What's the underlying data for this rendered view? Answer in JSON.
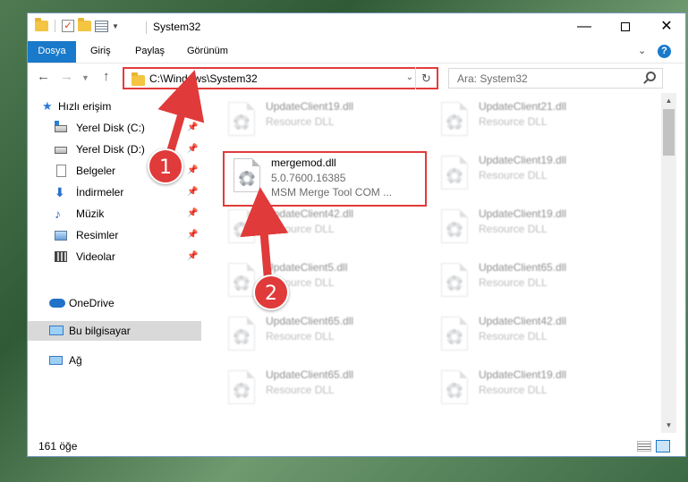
{
  "window": {
    "title": "System32"
  },
  "ribbon": {
    "tabs": [
      "Dosya",
      "Giriş",
      "Paylaş",
      "Görünüm"
    ]
  },
  "nav": {
    "address": "C:\\Windows\\System32",
    "search_placeholder": "Ara: System32"
  },
  "sidebar": {
    "items": [
      {
        "label": "Hızlı erişim",
        "icon": "star-icon"
      },
      {
        "label": "Yerel Disk (C:)",
        "icon": "drive-icon",
        "pinned": true
      },
      {
        "label": "Yerel Disk (D:)",
        "icon": "drive-icon",
        "pinned": true
      },
      {
        "label": "Belgeler",
        "icon": "documents-icon",
        "pinned": true
      },
      {
        "label": "İndirmeler",
        "icon": "download-icon",
        "pinned": true
      },
      {
        "label": "Müzik",
        "icon": "music-icon",
        "pinned": true
      },
      {
        "label": "Resimler",
        "icon": "pictures-icon",
        "pinned": true
      },
      {
        "label": "Videolar",
        "icon": "videos-icon",
        "pinned": true
      },
      {
        "label": "OneDrive",
        "icon": "cloud-icon"
      },
      {
        "label": "Bu bilgisayar",
        "icon": "computer-icon",
        "selected": true
      },
      {
        "label": "Ağ",
        "icon": "network-icon"
      }
    ]
  },
  "files": [
    {
      "name": "UpdateClient19.dll",
      "type": "Resource DLL"
    },
    {
      "name": "UpdateClient21.dll",
      "type": "Resource DLL"
    },
    {
      "name": "mergemod.dll",
      "version": "5.0.7600.16385",
      "description": "MSM Merge Tool COM ..."
    },
    {
      "name": "UpdateClient19.dll",
      "type": "Resource DLL"
    },
    {
      "name": "UpdateClient42.dll",
      "type": "Resource DLL"
    },
    {
      "name": "UpdateClient19.dll",
      "type": "Resource DLL"
    },
    {
      "name": "UpdateClient5.dll",
      "type": "Resource DLL"
    },
    {
      "name": "UpdateClient65.dll",
      "type": "Resource DLL"
    },
    {
      "name": "UpdateClient65.dll",
      "type": "Resource DLL"
    },
    {
      "name": "UpdateClient42.dll",
      "type": "Resource DLL"
    },
    {
      "name": "UpdateClient65.dll",
      "type": "Resource DLL"
    },
    {
      "name": "UpdateClient19.dll",
      "type": "Resource DLL"
    }
  ],
  "status": {
    "item_count": "161 öğe"
  },
  "callouts": [
    "1",
    "2"
  ],
  "colors": {
    "accent": "#1979ca",
    "highlight": "#e23b3b"
  }
}
